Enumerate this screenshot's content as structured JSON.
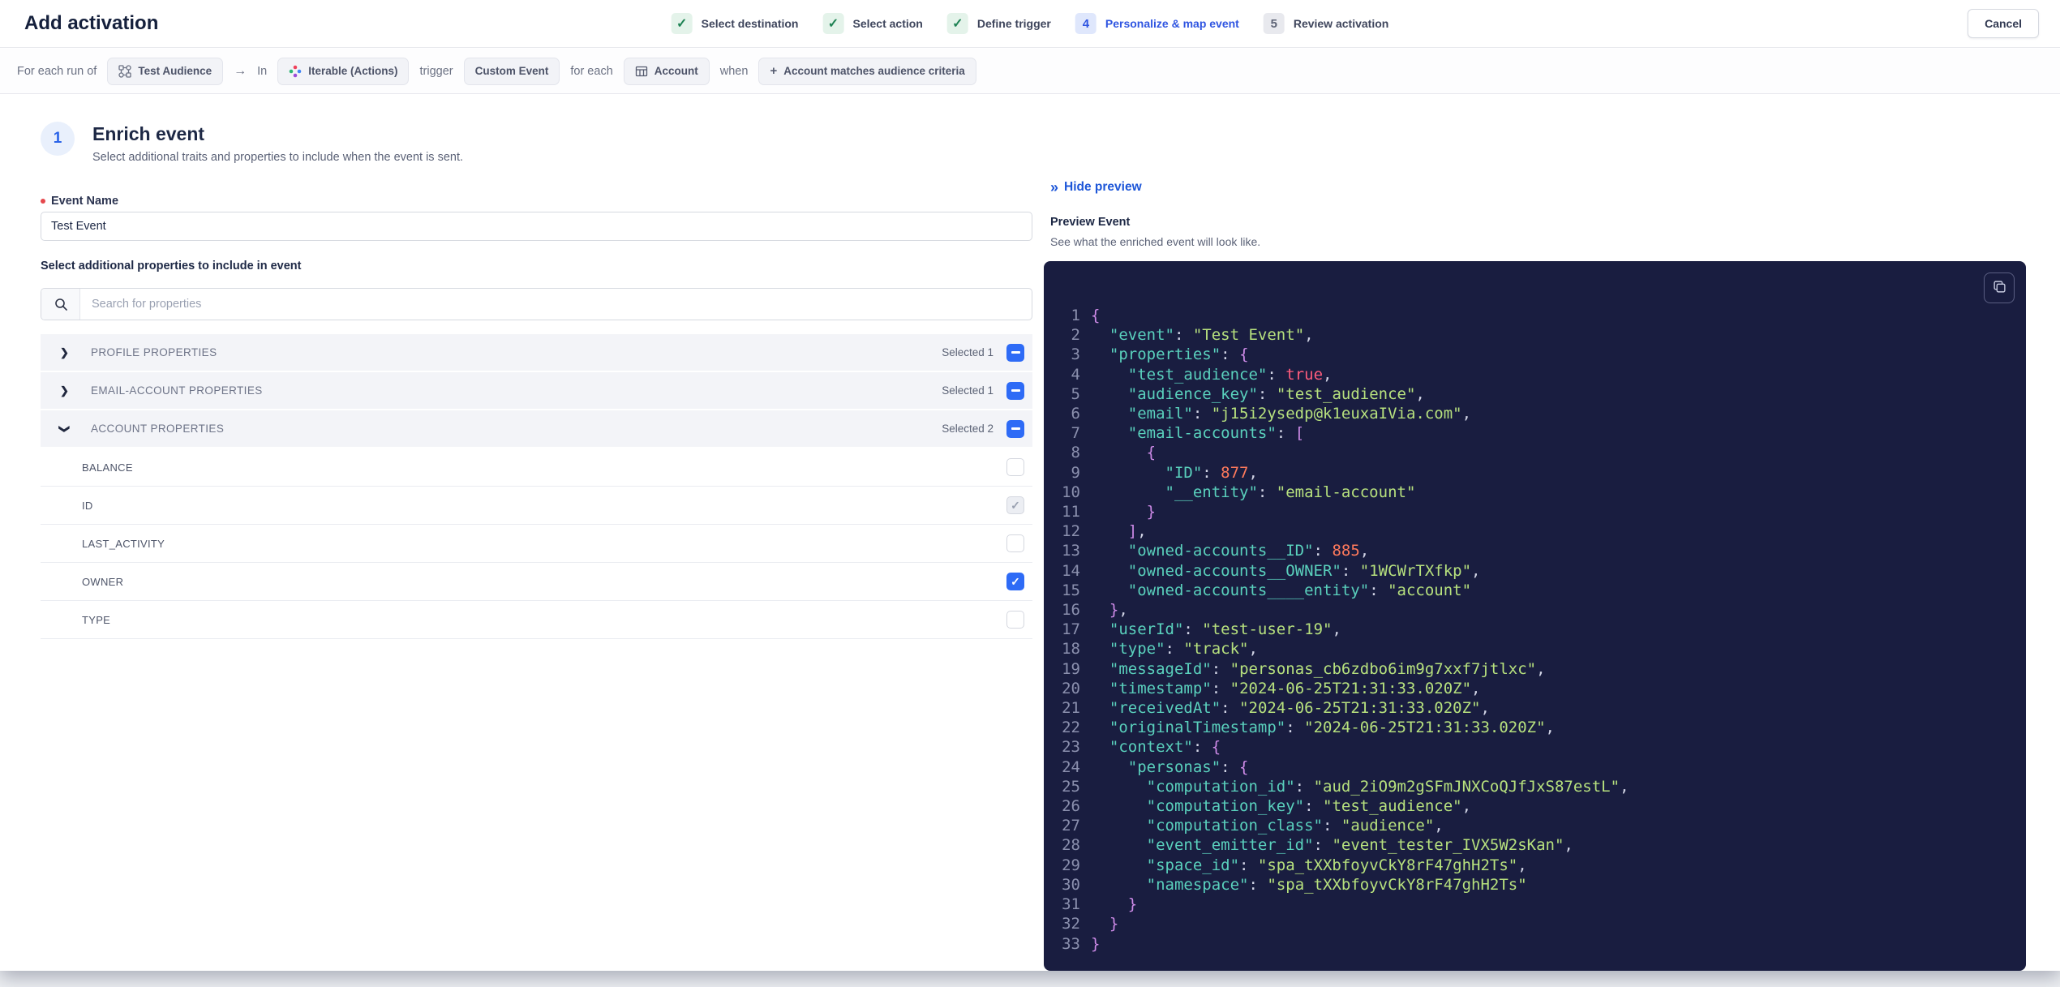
{
  "colors": {
    "accent-blue": "#2f55e1",
    "link-blue": "#1d56d8",
    "checkbox-blue": "#2e6bf6",
    "step-done-green": "#1f8354",
    "step-done-bg": "#e4f3ea",
    "step-active-bg": "#dfe7fc",
    "required-red": "#e5484d",
    "code-bg": "#191d40",
    "code-ln": "#8b90ae",
    "code-key": "#5ad1bd",
    "code-str": "#b7e17e",
    "code-num": "#ff7a5c",
    "code-bool": "#ff5c7c",
    "code-brace": "#ce8be8",
    "code-punct": "#d2d5e6"
  },
  "header": {
    "title": "Add activation",
    "cancel_label": "Cancel",
    "steps": [
      {
        "state": "done",
        "label": "Select destination"
      },
      {
        "state": "done",
        "label": "Select action"
      },
      {
        "state": "done",
        "label": "Define trigger"
      },
      {
        "state": "active",
        "num": "4",
        "label": "Personalize & map event"
      },
      {
        "state": "todo",
        "num": "5",
        "label": "Review activation"
      }
    ]
  },
  "trigger_bar": {
    "segments": [
      {
        "type": "text",
        "text": "For each run of"
      },
      {
        "type": "pill",
        "icon": "audience-icon",
        "label": "Test Audience",
        "interactable": false
      },
      {
        "type": "icon",
        "icon": "arrow-right-icon"
      },
      {
        "type": "text",
        "text": "In"
      },
      {
        "type": "pill",
        "icon": "iterable-icon",
        "label": "Iterable (Actions)",
        "interactable": false
      },
      {
        "type": "text",
        "text": "trigger"
      },
      {
        "type": "pill",
        "label": "Custom Event",
        "interactable": false
      },
      {
        "type": "text",
        "text": "for each"
      },
      {
        "type": "pill",
        "icon": "table-icon",
        "label": "Account",
        "interactable": false
      },
      {
        "type": "text",
        "text": "when"
      },
      {
        "type": "pill",
        "icon": "plus-icon",
        "label": "Account matches audience criteria",
        "interactable": true
      }
    ]
  },
  "enrich": {
    "step_number": "1",
    "title": "Enrich event",
    "subtitle": "Select additional traits and properties to include when the event is sent.",
    "event_name_label": "Event Name",
    "event_name_value": "Test Event",
    "properties_label": "Select additional properties to include in event",
    "search_placeholder": "Search for properties",
    "groups": [
      {
        "label": "PROFILE PROPERTIES",
        "selected_text": "Selected 1",
        "expanded": false
      },
      {
        "label": "EMAIL-ACCOUNT PROPERTIES",
        "selected_text": "Selected 1",
        "expanded": false
      },
      {
        "label": "ACCOUNT PROPERTIES",
        "selected_text": "Selected 2",
        "expanded": true,
        "rows": [
          {
            "label": "BALANCE",
            "checkbox": "unchecked"
          },
          {
            "label": "ID",
            "checkbox": "checked-disabled"
          },
          {
            "label": "LAST_ACTIVITY",
            "checkbox": "unchecked"
          },
          {
            "label": "OWNER",
            "checkbox": "checked"
          },
          {
            "label": "TYPE",
            "checkbox": "unchecked"
          }
        ]
      }
    ]
  },
  "preview": {
    "hide_label": "Hide preview",
    "title": "Preview Event",
    "subtitle": "See what the enriched event will look like.",
    "code_lines": [
      {
        "n": "1",
        "t": [
          [
            "br",
            "{"
          ]
        ]
      },
      {
        "n": "2",
        "t": [
          [
            "p",
            "  "
          ],
          [
            "k",
            "\"event\""
          ],
          [
            "p",
            ": "
          ],
          [
            "s",
            "\"Test Event\""
          ],
          [
            "p",
            ","
          ]
        ]
      },
      {
        "n": "3",
        "t": [
          [
            "p",
            "  "
          ],
          [
            "k",
            "\"properties\""
          ],
          [
            "p",
            ": "
          ],
          [
            "br",
            "{"
          ]
        ]
      },
      {
        "n": "4",
        "t": [
          [
            "p",
            "    "
          ],
          [
            "k",
            "\"test_audience\""
          ],
          [
            "p",
            ": "
          ],
          [
            "b",
            "true"
          ],
          [
            "p",
            ","
          ]
        ]
      },
      {
        "n": "5",
        "t": [
          [
            "p",
            "    "
          ],
          [
            "k",
            "\"audience_key\""
          ],
          [
            "p",
            ": "
          ],
          [
            "s",
            "\"test_audience\""
          ],
          [
            "p",
            ","
          ]
        ]
      },
      {
        "n": "6",
        "t": [
          [
            "p",
            "    "
          ],
          [
            "k",
            "\"email\""
          ],
          [
            "p",
            ": "
          ],
          [
            "s",
            "\"j15i2ysedp@k1euxaIVia.com\""
          ],
          [
            "p",
            ","
          ]
        ]
      },
      {
        "n": "7",
        "t": [
          [
            "p",
            "    "
          ],
          [
            "k",
            "\"email-accounts\""
          ],
          [
            "p",
            ": "
          ],
          [
            "br",
            "["
          ]
        ]
      },
      {
        "n": "8",
        "t": [
          [
            "p",
            "      "
          ],
          [
            "br",
            "{"
          ]
        ]
      },
      {
        "n": "9",
        "t": [
          [
            "p",
            "        "
          ],
          [
            "k",
            "\"ID\""
          ],
          [
            "p",
            ": "
          ],
          [
            "n",
            "877"
          ],
          [
            "p",
            ","
          ]
        ]
      },
      {
        "n": "10",
        "t": [
          [
            "p",
            "        "
          ],
          [
            "k",
            "\"__entity\""
          ],
          [
            "p",
            ": "
          ],
          [
            "s",
            "\"email-account\""
          ]
        ]
      },
      {
        "n": "11",
        "t": [
          [
            "p",
            "      "
          ],
          [
            "br",
            "}"
          ]
        ]
      },
      {
        "n": "12",
        "t": [
          [
            "p",
            "    "
          ],
          [
            "br",
            "]"
          ],
          [
            "p",
            ","
          ]
        ]
      },
      {
        "n": "13",
        "t": [
          [
            "p",
            "    "
          ],
          [
            "k",
            "\"owned-accounts__ID\""
          ],
          [
            "p",
            ": "
          ],
          [
            "n",
            "885"
          ],
          [
            "p",
            ","
          ]
        ]
      },
      {
        "n": "14",
        "t": [
          [
            "p",
            "    "
          ],
          [
            "k",
            "\"owned-accounts__OWNER\""
          ],
          [
            "p",
            ": "
          ],
          [
            "s",
            "\"1WCWrTXfkp\""
          ],
          [
            "p",
            ","
          ]
        ]
      },
      {
        "n": "15",
        "t": [
          [
            "p",
            "    "
          ],
          [
            "k",
            "\"owned-accounts____entity\""
          ],
          [
            "p",
            ": "
          ],
          [
            "s",
            "\"account\""
          ]
        ]
      },
      {
        "n": "16",
        "t": [
          [
            "p",
            "  "
          ],
          [
            "br",
            "}"
          ],
          [
            "p",
            ","
          ]
        ]
      },
      {
        "n": "17",
        "t": [
          [
            "p",
            "  "
          ],
          [
            "k",
            "\"userId\""
          ],
          [
            "p",
            ": "
          ],
          [
            "s",
            "\"test-user-19\""
          ],
          [
            "p",
            ","
          ]
        ]
      },
      {
        "n": "18",
        "t": [
          [
            "p",
            "  "
          ],
          [
            "k",
            "\"type\""
          ],
          [
            "p",
            ": "
          ],
          [
            "s",
            "\"track\""
          ],
          [
            "p",
            ","
          ]
        ]
      },
      {
        "n": "19",
        "t": [
          [
            "p",
            "  "
          ],
          [
            "k",
            "\"messageId\""
          ],
          [
            "p",
            ": "
          ],
          [
            "s",
            "\"personas_cb6zdbo6im9g7xxf7jtlxc\""
          ],
          [
            "p",
            ","
          ]
        ]
      },
      {
        "n": "20",
        "t": [
          [
            "p",
            "  "
          ],
          [
            "k",
            "\"timestamp\""
          ],
          [
            "p",
            ": "
          ],
          [
            "s",
            "\"2024-06-25T21:31:33.020Z\""
          ],
          [
            "p",
            ","
          ]
        ]
      },
      {
        "n": "21",
        "t": [
          [
            "p",
            "  "
          ],
          [
            "k",
            "\"receivedAt\""
          ],
          [
            "p",
            ": "
          ],
          [
            "s",
            "\"2024-06-25T21:31:33.020Z\""
          ],
          [
            "p",
            ","
          ]
        ]
      },
      {
        "n": "22",
        "t": [
          [
            "p",
            "  "
          ],
          [
            "k",
            "\"originalTimestamp\""
          ],
          [
            "p",
            ": "
          ],
          [
            "s",
            "\"2024-06-25T21:31:33.020Z\""
          ],
          [
            "p",
            ","
          ]
        ]
      },
      {
        "n": "23",
        "t": [
          [
            "p",
            "  "
          ],
          [
            "k",
            "\"context\""
          ],
          [
            "p",
            ": "
          ],
          [
            "br",
            "{"
          ]
        ]
      },
      {
        "n": "24",
        "t": [
          [
            "p",
            "    "
          ],
          [
            "k",
            "\"personas\""
          ],
          [
            "p",
            ": "
          ],
          [
            "br",
            "{"
          ]
        ]
      },
      {
        "n": "25",
        "t": [
          [
            "p",
            "      "
          ],
          [
            "k",
            "\"computation_id\""
          ],
          [
            "p",
            ": "
          ],
          [
            "s",
            "\"aud_2iO9m2gSFmJNXCoQJfJxS87estL\""
          ],
          [
            "p",
            ","
          ]
        ]
      },
      {
        "n": "26",
        "t": [
          [
            "p",
            "      "
          ],
          [
            "k",
            "\"computation_key\""
          ],
          [
            "p",
            ": "
          ],
          [
            "s",
            "\"test_audience\""
          ],
          [
            "p",
            ","
          ]
        ]
      },
      {
        "n": "27",
        "t": [
          [
            "p",
            "      "
          ],
          [
            "k",
            "\"computation_class\""
          ],
          [
            "p",
            ": "
          ],
          [
            "s",
            "\"audience\""
          ],
          [
            "p",
            ","
          ]
        ]
      },
      {
        "n": "28",
        "t": [
          [
            "p",
            "      "
          ],
          [
            "k",
            "\"event_emitter_id\""
          ],
          [
            "p",
            ": "
          ],
          [
            "s",
            "\"event_tester_IVX5W2sKan\""
          ],
          [
            "p",
            ","
          ]
        ]
      },
      {
        "n": "29",
        "t": [
          [
            "p",
            "      "
          ],
          [
            "k",
            "\"space_id\""
          ],
          [
            "p",
            ": "
          ],
          [
            "s",
            "\"spa_tXXbfoyvCkY8rF47ghH2Ts\""
          ],
          [
            "p",
            ","
          ]
        ]
      },
      {
        "n": "30",
        "t": [
          [
            "p",
            "      "
          ],
          [
            "k",
            "\"namespace\""
          ],
          [
            "p",
            ": "
          ],
          [
            "s",
            "\"spa_tXXbfoyvCkY8rF47ghH2Ts\""
          ]
        ]
      },
      {
        "n": "31",
        "t": [
          [
            "p",
            "    "
          ],
          [
            "br",
            "}"
          ]
        ]
      },
      {
        "n": "32",
        "t": [
          [
            "p",
            "  "
          ],
          [
            "br",
            "}"
          ]
        ]
      },
      {
        "n": "33",
        "t": [
          [
            "br",
            "}"
          ]
        ]
      }
    ]
  }
}
